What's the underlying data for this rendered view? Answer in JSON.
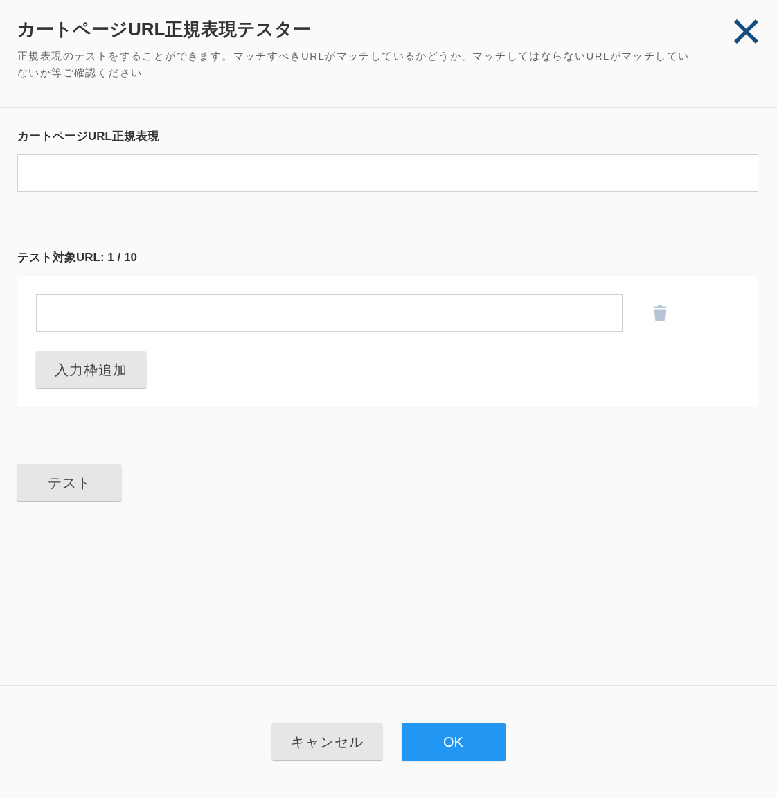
{
  "dialog": {
    "title": "カートページURL正規表現テスター",
    "description": "正規表現のテストをすることができます。マッチすべきURLがマッチしているかどうか、マッチしてはならないURLがマッチしていないか等ご確認ください"
  },
  "regex_field": {
    "label": "カートページURL正規表現"
  },
  "test_urls": {
    "label": "テスト対象URL: 1 / 10",
    "fields": [
      {
        "kind": "url"
      }
    ],
    "add_button": "入力枠追加"
  },
  "test_button": "テスト",
  "footer_buttons": [
    {
      "label": "キャンセル",
      "kind": "secondary"
    },
    {
      "label": "OK",
      "kind": "primary"
    }
  ]
}
